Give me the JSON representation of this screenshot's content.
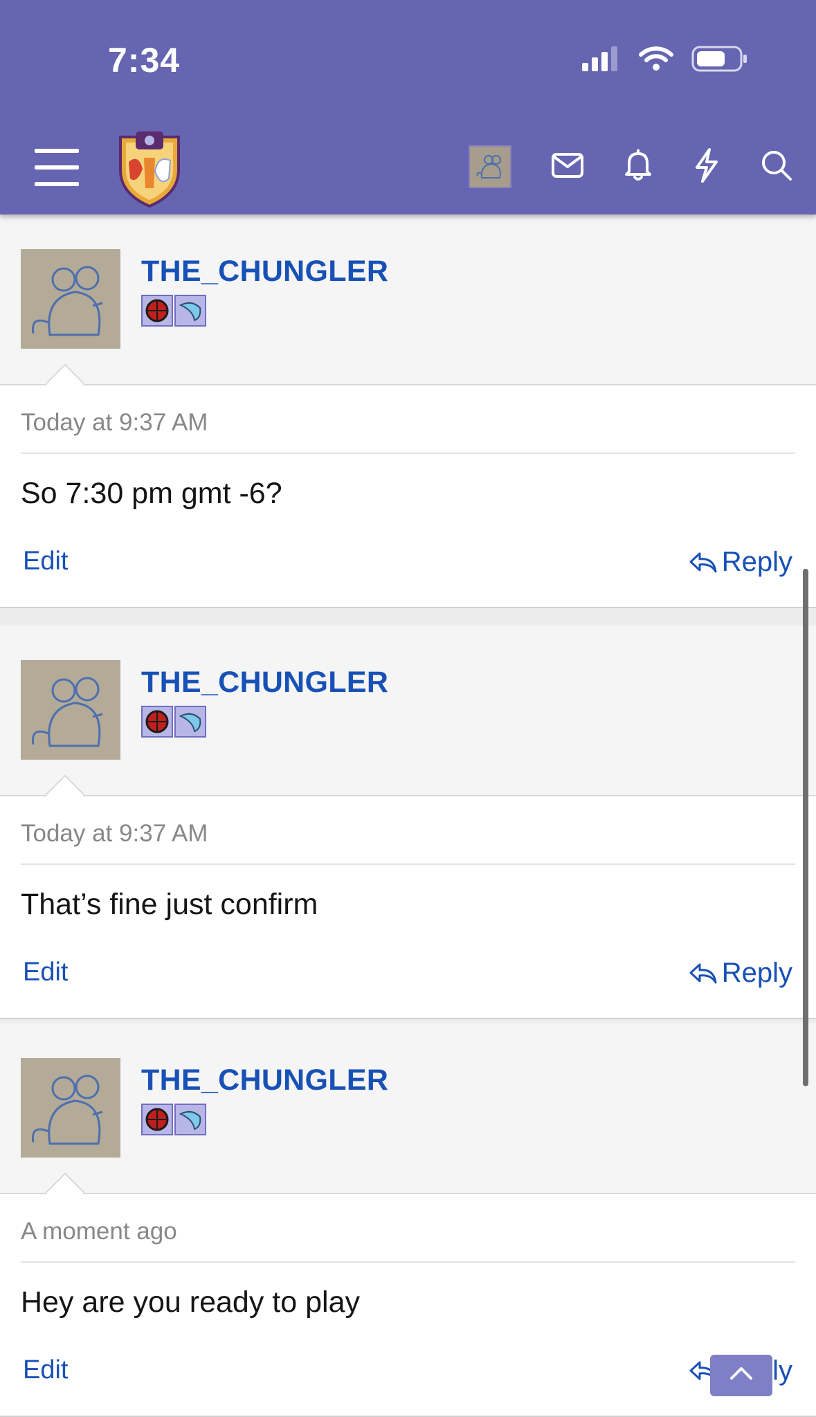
{
  "status_bar": {
    "time": "7:34"
  },
  "nav": {
    "menu_icon": "hamburger-icon",
    "logo_icon": "forum-crest-logo",
    "actions": [
      "avatar",
      "envelope-icon",
      "bell-icon",
      "lightning-icon",
      "search-icon"
    ]
  },
  "posts": [
    {
      "username": "THE_CHUNGLER",
      "timestamp": "Today at 9:37 AM",
      "body": "So 7:30 pm gmt -6?",
      "edit_label": "Edit",
      "reply_label": "Reply"
    },
    {
      "username": "THE_CHUNGLER",
      "timestamp": "Today at 9:37 AM",
      "body": "That’s fine just confirm",
      "edit_label": "Edit",
      "reply_label": "Reply"
    },
    {
      "username": "THE_CHUNGLER",
      "timestamp": "A moment ago",
      "body": "Hey are you ready to play",
      "edit_label": "Edit",
      "reply_label": "Reply"
    }
  ],
  "colors": {
    "header": "#6665b1",
    "link": "#1851b6",
    "badge_bg": "#b7b6e6"
  }
}
